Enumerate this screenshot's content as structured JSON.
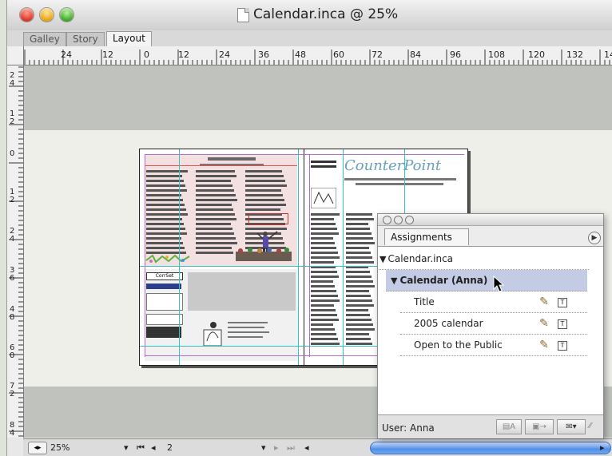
{
  "window": {
    "title": "Calendar.inca @ 25%"
  },
  "view_tabs": [
    {
      "label": "Galley"
    },
    {
      "label": "Story"
    },
    {
      "label": "Layout"
    }
  ],
  "ruler": {
    "horizontal": [
      "24",
      "12",
      "0",
      "12",
      "24",
      "36",
      "48",
      "60",
      "72",
      "84",
      "96",
      "108",
      "120",
      "132",
      "14"
    ],
    "vertical": [
      "24",
      "12",
      "0",
      "12",
      "24",
      "36",
      "48",
      "60",
      "72",
      "84"
    ]
  },
  "document": {
    "masthead": "CounterPoint"
  },
  "assignments_panel": {
    "tab_label": "Assignments",
    "tree": [
      {
        "label": "Calendar.inca",
        "level": 0,
        "expanded": true
      },
      {
        "label": "Calendar (Anna)",
        "level": 1,
        "expanded": true,
        "selected": true
      },
      {
        "label": "Title",
        "level": 2
      },
      {
        "label": "2005 calendar",
        "level": 2
      },
      {
        "label": "Open to the Public",
        "level": 2
      }
    ],
    "user_label": "User: Anna",
    "icons": {
      "edit": "pencil-icon",
      "type": "text-frame-icon"
    }
  },
  "bottom_bar": {
    "zoom": "25%",
    "page": "2"
  }
}
